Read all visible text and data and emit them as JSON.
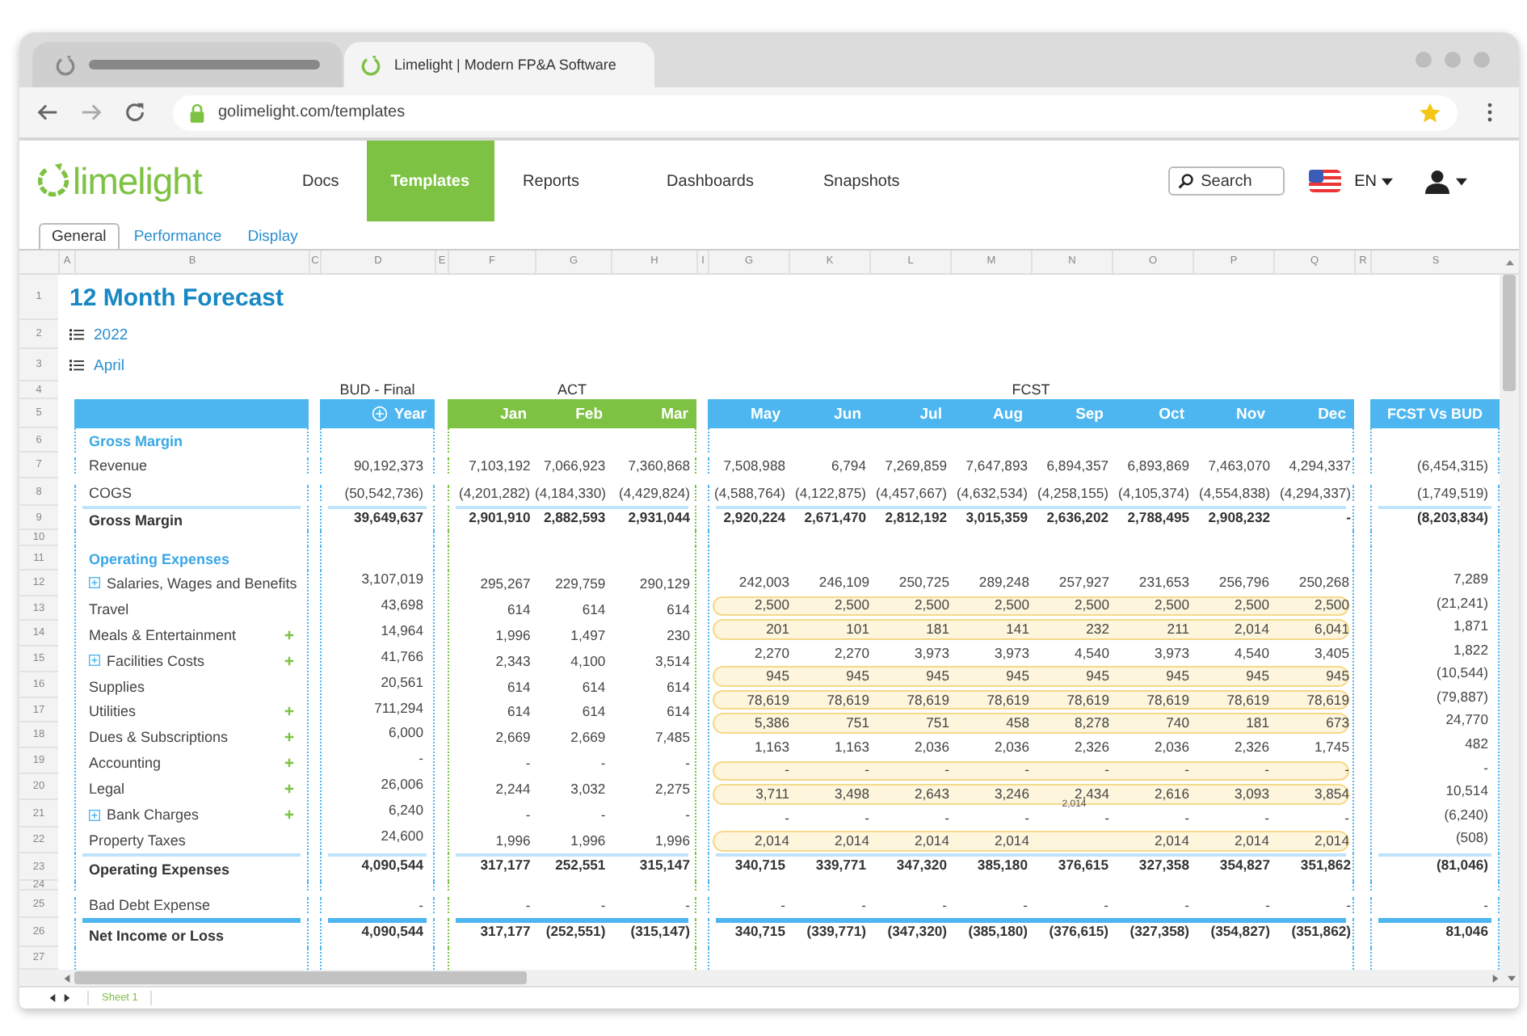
{
  "browser": {
    "tabs": [
      {
        "selected": false
      },
      {
        "title": "Limelight | Modern FP&A Software",
        "selected": true
      }
    ],
    "address": "golimelight.com/templates"
  },
  "nav": {
    "logo": "limelight",
    "items": [
      {
        "label": "Docs",
        "selected": false
      },
      {
        "label": "Templates",
        "selected": true
      },
      {
        "label": "Reports",
        "selected": false
      },
      {
        "label": "Dashboards",
        "selected": false
      },
      {
        "label": "Snapshots",
        "selected": false
      }
    ],
    "search_placeholder": "Search",
    "language": "EN"
  },
  "subtabs": [
    {
      "label": "General",
      "selected": true
    },
    {
      "label": "Performance",
      "selected": false
    },
    {
      "label": "Display",
      "selected": false
    }
  ],
  "sheet": {
    "columns": [
      "A",
      "B",
      "C",
      "D",
      "E",
      "F",
      "G",
      "H",
      "I",
      "G",
      "K",
      "L",
      "M",
      "N",
      "O",
      "P",
      "Q",
      "R",
      "S"
    ],
    "row_numbers": [
      "1",
      "2",
      "3",
      "4",
      "5",
      "6",
      "7",
      "8",
      "9",
      "10",
      "11",
      "12",
      "13",
      "14",
      "15",
      "16",
      "17",
      "18",
      "19",
      "20",
      "21",
      "22",
      "23",
      "24",
      "25",
      "26",
      "27"
    ],
    "title": "12 Month Forecast",
    "filters": [
      "2022",
      "April"
    ],
    "groups": {
      "budget": "BUD - Final",
      "actual": "ACT",
      "forecast": "FCST"
    },
    "headers": {
      "year": "Year",
      "actual": [
        "Jan",
        "Feb",
        "Mar"
      ],
      "forecast": [
        "May",
        "Jun",
        "Jul",
        "Aug",
        "Sep",
        "Oct",
        "Nov",
        "Dec"
      ],
      "variance": "FCST Vs BUD"
    },
    "rows": [
      {
        "kind": "section",
        "label": "Gross Margin"
      },
      {
        "kind": "line",
        "label": "Revenue",
        "bud": "90,192,373",
        "act": [
          "7,103,192",
          "7,066,923",
          "7,360,868"
        ],
        "fcst": [
          "7,508,988",
          "6,794",
          "7,269,859",
          "7,647,893",
          "6,894,357",
          "6,893,869",
          "7,463,070",
          "4,294,337"
        ],
        "variance": "(6,454,315)"
      },
      {
        "kind": "line",
        "label": "COGS",
        "bud": "(50,542,736)",
        "act": [
          "(4,201,282)",
          "(4,184,330)",
          "(4,429,824)"
        ],
        "fcst": [
          "(4,588,764)",
          "(4,122,875)",
          "(4,457,667)",
          "(4,632,534)",
          "(4,258,155)",
          "(4,105,374)",
          "(4,554,838)",
          "(4,294,337)"
        ],
        "variance": "(1,749,519)"
      },
      {
        "kind": "subtotal",
        "label": "Gross Margin",
        "bud": "39,649,637",
        "act": [
          "2,901,910",
          "2,882,593",
          "2,931,044"
        ],
        "fcst": [
          "2,920,224",
          "2,671,470",
          "2,812,192",
          "3,015,359",
          "2,636,202",
          "2,788,495",
          "2,908,232",
          "-"
        ],
        "variance": "(8,203,834)"
      },
      {
        "kind": "blank"
      },
      {
        "kind": "section",
        "label": "Operating Expenses"
      },
      {
        "kind": "detail",
        "items": [
          {
            "label": "Salaries, Wages and Benefits",
            "expandable": true,
            "add": false,
            "bud": "3,107,019",
            "act": [
              "295,267",
              "229,759",
              "290,129"
            ]
          },
          {
            "label": "Travel",
            "expandable": false,
            "add": false,
            "bud": "43,698",
            "act": [
              "614",
              "614",
              "614"
            ]
          },
          {
            "label": "Meals & Entertainment",
            "expandable": false,
            "add": true,
            "bud": "14,964",
            "act": [
              "1,996",
              "1,497",
              "230"
            ]
          },
          {
            "label": "Facilities Costs",
            "expandable": true,
            "add": true,
            "bud": "41,766",
            "act": [
              "2,343",
              "4,100",
              "3,514"
            ]
          },
          {
            "label": "Supplies",
            "expandable": false,
            "add": false,
            "bud": "20,561",
            "act": [
              "614",
              "614",
              "614"
            ]
          },
          {
            "label": "Utilities",
            "expandable": false,
            "add": true,
            "bud": "711,294",
            "act": [
              "614",
              "614",
              "614"
            ]
          },
          {
            "label": "Dues & Subscriptions",
            "expandable": false,
            "add": true,
            "bud": "6,000",
            "act": [
              "2,669",
              "2,669",
              "7,485"
            ]
          },
          {
            "label": "Accounting",
            "expandable": false,
            "add": true,
            "bud": "-",
            "act": [
              "-",
              "-",
              "-"
            ]
          },
          {
            "label": "Legal",
            "expandable": false,
            "add": true,
            "bud": "26,006",
            "act": [
              "2,244",
              "3,032",
              "2,275"
            ]
          },
          {
            "label": "Bank Charges",
            "expandable": true,
            "add": true,
            "bud": "6,240",
            "act": [
              "-",
              "-",
              "-"
            ]
          },
          {
            "label": "Property Taxes",
            "expandable": false,
            "add": false,
            "bud": "24,600",
            "act": [
              "1,996",
              "1,996",
              "1,996"
            ]
          }
        ],
        "forecast": [
          {
            "highlighted": false,
            "fcst": [
              "242,003",
              "246,109",
              "250,725",
              "289,248",
              "257,927",
              "231,653",
              "256,796",
              "250,268"
            ],
            "variance": "7,289"
          },
          {
            "highlighted": true,
            "fcst": [
              "2,500",
              "2,500",
              "2,500",
              "2,500",
              "2,500",
              "2,500",
              "2,500",
              "2,500"
            ],
            "variance": "(21,241)"
          },
          {
            "highlighted": true,
            "fcst": [
              "201",
              "101",
              "181",
              "141",
              "232",
              "211",
              "2,014",
              "6,041"
            ],
            "variance": "1,871"
          },
          {
            "highlighted": false,
            "fcst": [
              "2,270",
              "2,270",
              "3,973",
              "3,973",
              "4,540",
              "3,973",
              "4,540",
              "3,405"
            ],
            "variance": "1,822"
          },
          {
            "highlighted": true,
            "fcst": [
              "945",
              "945",
              "945",
              "945",
              "945",
              "945",
              "945",
              "945"
            ],
            "variance": "(10,544)"
          },
          {
            "highlighted": true,
            "fcst": [
              "78,619",
              "78,619",
              "78,619",
              "78,619",
              "78,619",
              "78,619",
              "78,619",
              "78,619"
            ],
            "variance": "(79,887)"
          },
          {
            "highlighted": true,
            "fcst": [
              "5,386",
              "751",
              "751",
              "458",
              "8,278",
              "740",
              "181",
              "673"
            ],
            "variance": "24,770"
          },
          {
            "highlighted": false,
            "fcst": [
              "1,163",
              "1,163",
              "2,036",
              "2,036",
              "2,326",
              "2,036",
              "2,326",
              "1,745"
            ],
            "variance": "482"
          },
          {
            "highlighted": true,
            "fcst": [
              "-",
              "-",
              "-",
              "-",
              "-",
              "-",
              "-",
              "-"
            ],
            "variance": "-"
          },
          {
            "highlighted": true,
            "fcst": [
              "3,711",
              "3,498",
              "2,643",
              "3,246",
              "2,434",
              "2,616",
              "3,093",
              "3,854"
            ],
            "variance": "10,514"
          },
          {
            "highlighted": false,
            "fcst": [
              "-",
              "-",
              "-",
              "-",
              "-",
              "-",
              "-",
              "-"
            ],
            "variance": "(6,240)"
          },
          {
            "highlighted": true,
            "fcst": [
              "2,014",
              "2,014",
              "2,014",
              "2,014",
              {
                "floating_value": "2,014"
              },
              "2,014",
              "2,014",
              "2,014"
            ],
            "variance": "(508)"
          }
        ]
      },
      {
        "kind": "subtotal",
        "label": "Operating Expenses",
        "bud": "4,090,544",
        "act": [
          "317,177",
          "252,551",
          "315,147"
        ],
        "fcst": [
          "340,715",
          "339,771",
          "347,320",
          "385,180",
          "376,615",
          "327,358",
          "354,827",
          "351,862"
        ],
        "variance": "(81,046)"
      },
      {
        "kind": "blank"
      },
      {
        "kind": "line",
        "label": "Bad Debt Expense",
        "bud": "-",
        "act": [
          "-",
          "-",
          "-"
        ],
        "fcst": [
          "-",
          "-",
          "-",
          "-",
          "-",
          "-",
          "-",
          "-"
        ],
        "variance": "-"
      },
      {
        "kind": "total",
        "label": "Net Income or Loss",
        "bud": "4,090,544",
        "act": [
          "317,177",
          "(252,551)",
          "(315,147)"
        ],
        "fcst": [
          "340,715",
          "(339,771)",
          "(347,320)",
          "(385,180)",
          "(376,615)",
          "(327,358)",
          "(354,827)",
          "(351,862)"
        ],
        "variance": "81,046"
      },
      {
        "kind": "blank"
      }
    ]
  },
  "sheet_tabs": [
    {
      "label": "Sheet 1",
      "selected": true
    }
  ]
}
